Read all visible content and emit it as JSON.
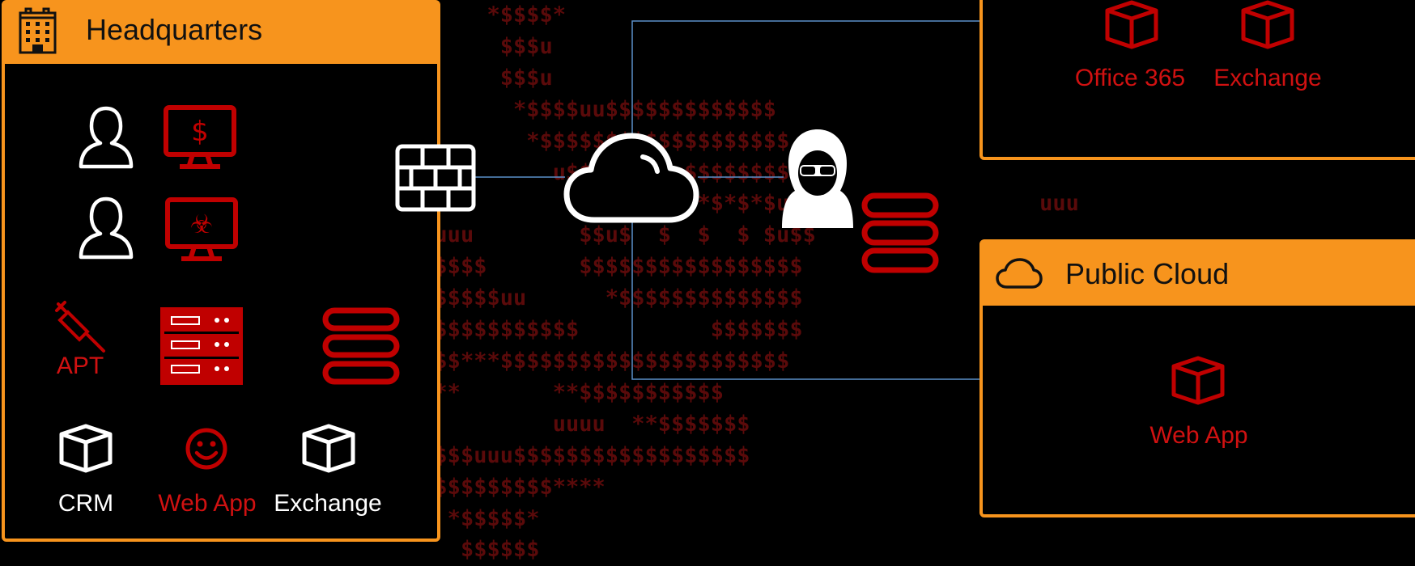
{
  "background_ascii": "                                     *$$$$*\n                                      $$$u\n                                      $$$u\n                                       *$$$$uu$$$$$$$$$$$$$\n                                        *$$$$$$$$$$$$$$$$$$$\n                                          u$$$$$$$$u$$$$$$$$u\n                                           u$*$*$*$*$*$*$*$u                   uuu\n                                 uuu        $$u$  $  $  $ $u$$\n                                u$$$$       $$$$$$$$$$$$$$$$$\n                                 $$$$$uu      *$$$$$$$$$$$$$$\n                               u$$$$$$$$$$$$          $$$$$$$\n                               $$$$***$$$$$$$$$$$$$$$$$$$$$$\n                                ***       **$$$$$$$$$$$\n                                          uuuu  **$$$$$$$\n                                u$$$uuu$$$$$$$$$$$$$$$$$$\n                                $$$$$$$$$$****\n                                  *$$$$$*\n                                   $$$$$$",
  "headquarters": {
    "title": "Headquarters",
    "labels": {
      "apt": "APT",
      "crm": "CRM",
      "web_app": "Web App",
      "exchange": "Exchange"
    }
  },
  "saas": {
    "labels": {
      "office365": "Office 365",
      "exchange": "Exchange"
    }
  },
  "public_cloud": {
    "title": "Public Cloud",
    "labels": {
      "web_app": "Web App"
    }
  },
  "colors": {
    "panel_orange": "#f7941d",
    "threat_red": "#c00000",
    "label_red": "#d01111",
    "connector_blue": "#5b8fc9",
    "ascii_dark_red": "#5a0a0a",
    "icon_white": "#ffffff"
  }
}
